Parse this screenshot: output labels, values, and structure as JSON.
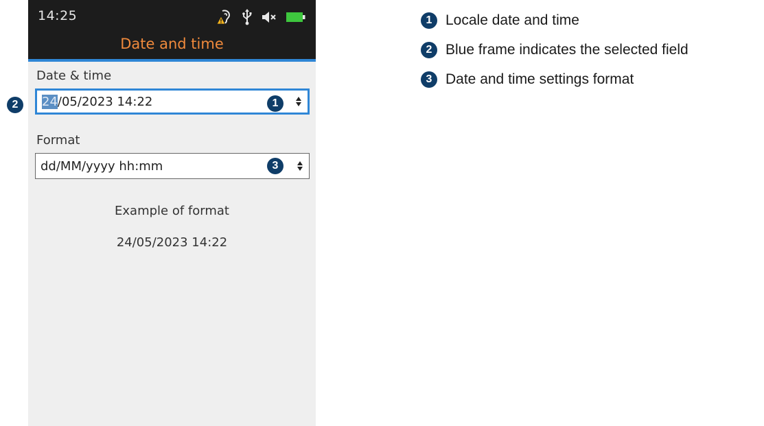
{
  "status_bar": {
    "time": "14:25",
    "icons": [
      "hearing-warning-icon",
      "usb-icon",
      "speaker-muted-icon",
      "battery-icon"
    ],
    "battery_color": "#3ec63e"
  },
  "screen": {
    "title": "Date and time",
    "date_time_field": {
      "label": "Date & time",
      "highlighted_part": "24",
      "remaining_value": "/05/2023 14:22"
    },
    "format_field": {
      "label": "Format",
      "value": "dd/MM/yyyy hh:mm"
    },
    "example_label": "Example of format",
    "example_value": "24/05/2023 14:22"
  },
  "callouts": [
    {
      "number": "1",
      "text": "Locale date and time"
    },
    {
      "number": "2",
      "text": "Blue frame indicates the selected field"
    },
    {
      "number": "3",
      "text": "Date and time settings format"
    }
  ],
  "colors": {
    "title": "#f08a3c",
    "selection_frame": "#2f86d6",
    "badge": "#0f3d68"
  }
}
